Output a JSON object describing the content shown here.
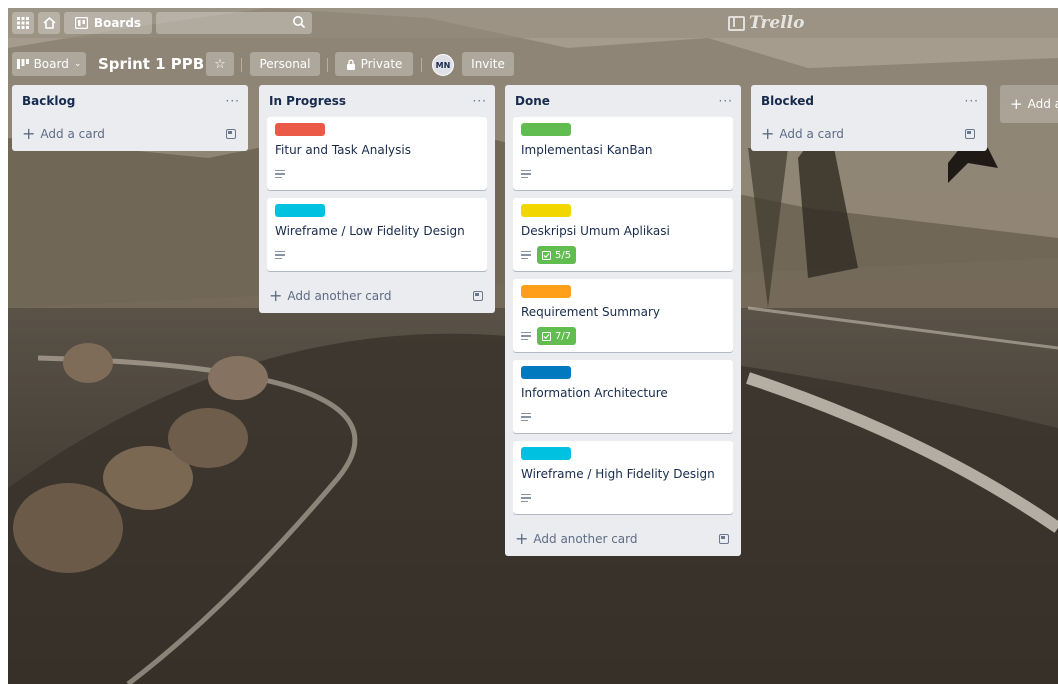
{
  "header": {
    "boards_label": "Boards",
    "logo_text": "Trello"
  },
  "board": {
    "view_label": "Board",
    "title": "Sprint 1 PPB",
    "team_label": "Personal",
    "visibility_label": "Private",
    "member_initials": "MN",
    "invite_label": "Invite"
  },
  "lists": [
    {
      "title": "Backlog",
      "menu": "···",
      "add_label": "Add a card",
      "cards": []
    },
    {
      "title": "In Progress",
      "menu": "···",
      "add_label": "Add another card",
      "cards": [
        {
          "title": "Fitur and Task Analysis",
          "label_color": "#eb5a46"
        },
        {
          "title": "Wireframe / Low Fidelity Design",
          "label_color": "#00c2e0"
        }
      ]
    },
    {
      "title": "Done",
      "menu": "···",
      "add_label": "Add another card",
      "cards": [
        {
          "title": "Implementasi KanBan",
          "label_color": "#61bd4f"
        },
        {
          "title": "Deskripsi Umum Aplikasi",
          "label_color": "#f2d600",
          "checklist": "5/5"
        },
        {
          "title": "Requirement Summary",
          "label_color": "#ff9f1a",
          "checklist": "7/7"
        },
        {
          "title": "Information Architecture",
          "label_color": "#0079bf"
        },
        {
          "title": "Wireframe / High Fidelity Design",
          "label_color": "#00c2e0"
        }
      ]
    },
    {
      "title": "Blocked",
      "menu": "···",
      "add_label": "Add a card",
      "cards": []
    }
  ],
  "add_list_label": "Add a",
  "colors": {
    "list_bg": "#ebecf0",
    "checklist_complete": "#61bd4f"
  }
}
